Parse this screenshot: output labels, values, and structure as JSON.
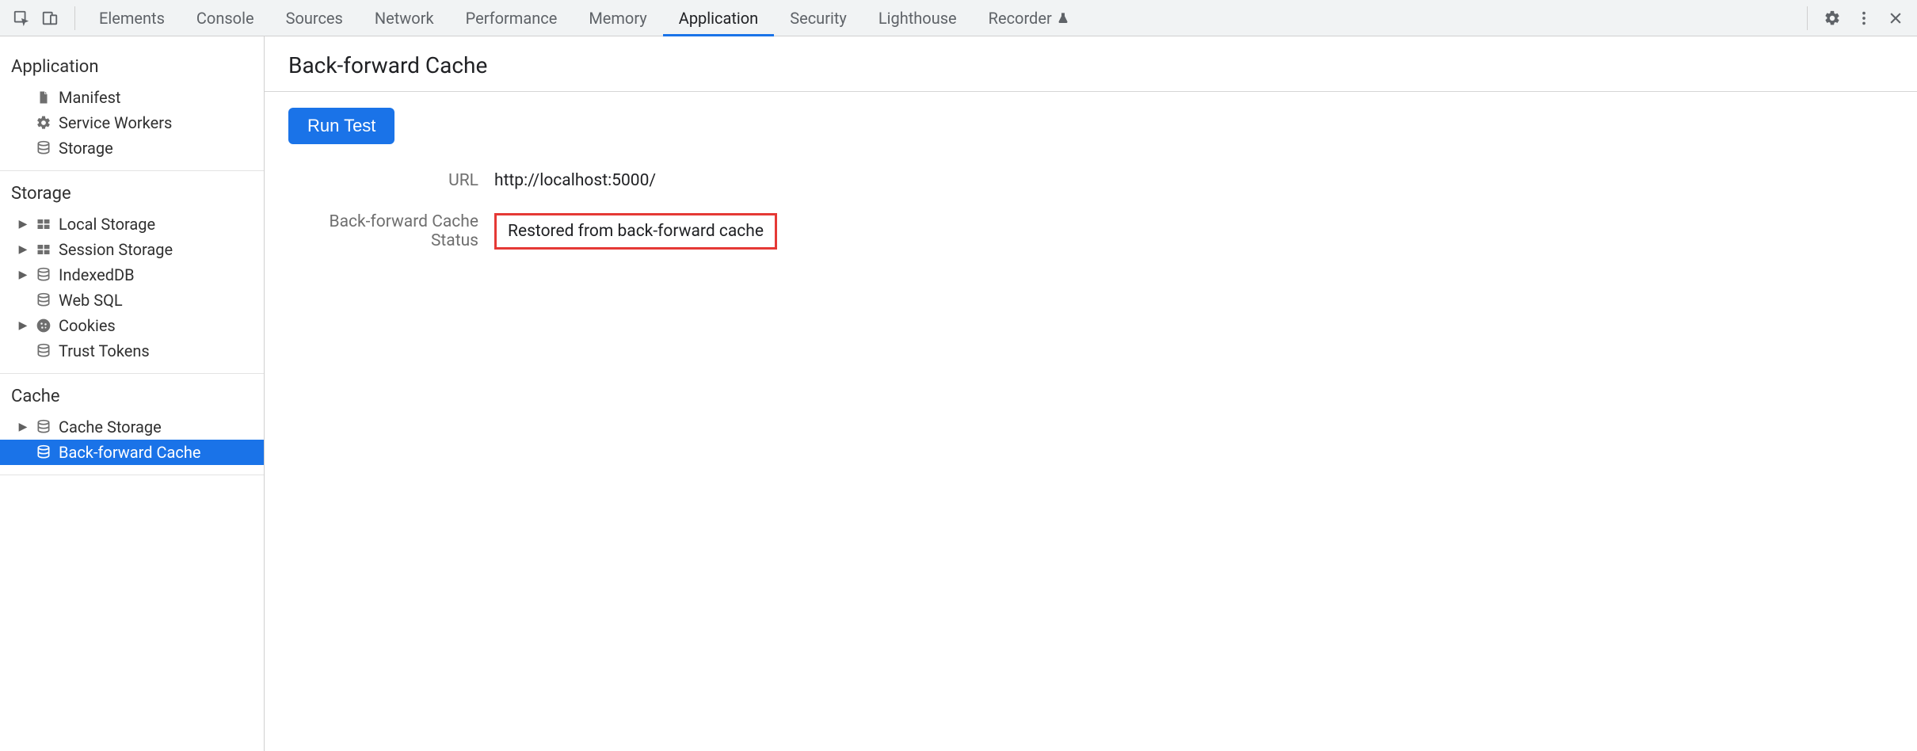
{
  "toolbar": {
    "tabs": [
      {
        "label": "Elements",
        "active": false
      },
      {
        "label": "Console",
        "active": false
      },
      {
        "label": "Sources",
        "active": false
      },
      {
        "label": "Network",
        "active": false
      },
      {
        "label": "Performance",
        "active": false
      },
      {
        "label": "Memory",
        "active": false
      },
      {
        "label": "Application",
        "active": true
      },
      {
        "label": "Security",
        "active": false
      },
      {
        "label": "Lighthouse",
        "active": false
      },
      {
        "label": "Recorder",
        "active": false,
        "flask": true
      }
    ]
  },
  "sidebar": {
    "sections": [
      {
        "title": "Application",
        "items": [
          {
            "label": "Manifest",
            "icon": "file",
            "expandable": false,
            "selected": false
          },
          {
            "label": "Service Workers",
            "icon": "gear",
            "expandable": false,
            "selected": false
          },
          {
            "label": "Storage",
            "icon": "db",
            "expandable": false,
            "selected": false
          }
        ]
      },
      {
        "title": "Storage",
        "items": [
          {
            "label": "Local Storage",
            "icon": "grid",
            "expandable": true,
            "selected": false
          },
          {
            "label": "Session Storage",
            "icon": "grid",
            "expandable": true,
            "selected": false
          },
          {
            "label": "IndexedDB",
            "icon": "db",
            "expandable": true,
            "selected": false
          },
          {
            "label": "Web SQL",
            "icon": "db",
            "expandable": false,
            "selected": false
          },
          {
            "label": "Cookies",
            "icon": "cookie",
            "expandable": true,
            "selected": false
          },
          {
            "label": "Trust Tokens",
            "icon": "db",
            "expandable": false,
            "selected": false
          }
        ]
      },
      {
        "title": "Cache",
        "items": [
          {
            "label": "Cache Storage",
            "icon": "db",
            "expandable": true,
            "selected": false
          },
          {
            "label": "Back-forward Cache",
            "icon": "db",
            "expandable": false,
            "selected": true
          }
        ]
      }
    ]
  },
  "content": {
    "title": "Back-forward Cache",
    "run_button": "Run Test",
    "rows": [
      {
        "label": "URL",
        "value": "http://localhost:5000/",
        "highlight": false
      },
      {
        "label": "Back-forward Cache Status",
        "value": "Restored from back-forward cache",
        "highlight": true
      }
    ]
  }
}
